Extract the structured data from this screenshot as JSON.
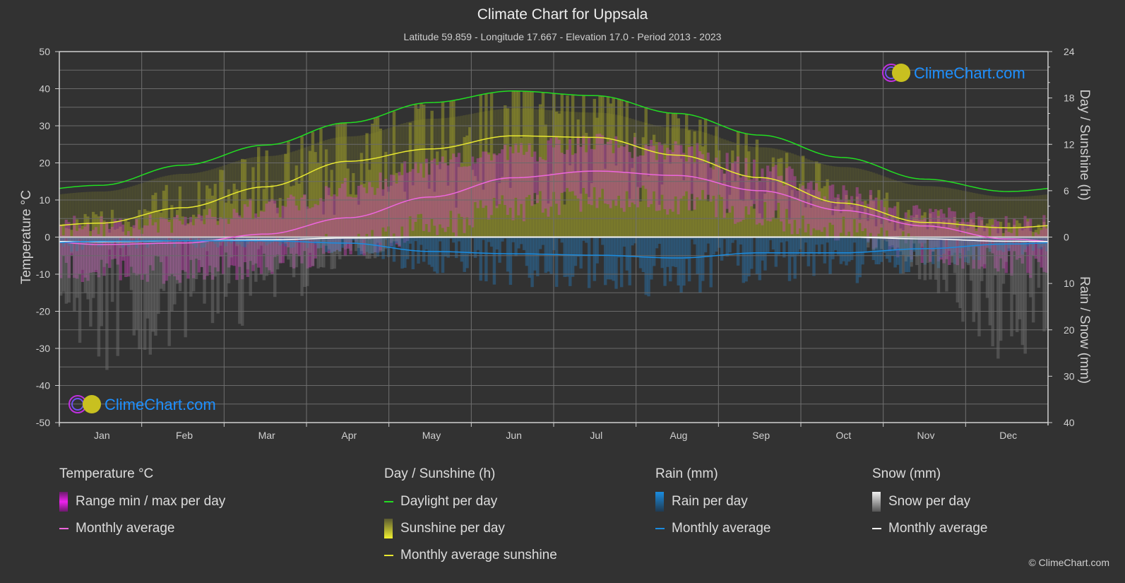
{
  "header": {
    "title": "Climate Chart for Uppsala",
    "subtitle": "Latitude 59.859 - Longitude 17.667 - Elevation 17.0 - Period 2013 - 2023"
  },
  "watermark": {
    "text": "ClimeChart.com"
  },
  "legend": {
    "temperature": {
      "heading": "Temperature °C",
      "items": [
        "Range min / max per day",
        "Monthly average"
      ]
    },
    "sunshine": {
      "heading": "Day / Sunshine (h)",
      "items": [
        "Daylight per day",
        "Sunshine per day",
        "Monthly average sunshine"
      ]
    },
    "rain": {
      "heading": "Rain (mm)",
      "items": [
        "Rain per day",
        "Monthly average"
      ]
    },
    "snow": {
      "heading": "Snow (mm)",
      "items": [
        "Snow per day",
        "Monthly average"
      ]
    }
  },
  "copyright": "© ClimeChart.com",
  "colors": {
    "background": "#323232",
    "daylight": "#22dd22",
    "sunshine_avg": "#e8e830",
    "sunshine_fill": "#9a9a2a",
    "temp_avg": "#ee66dd",
    "temp_range": "#cc44bb",
    "rain_avg": "#1a8ce0",
    "rain_fill": "#2a6a9a",
    "snow_avg": "#ffffff",
    "snow_fill": "#8a8a8a"
  },
  "chart_data": {
    "type": "line",
    "title": "Climate Chart for Uppsala",
    "categories": [
      "Jan",
      "Feb",
      "Mar",
      "Apr",
      "May",
      "Jun",
      "Jul",
      "Aug",
      "Sep",
      "Oct",
      "Nov",
      "Dec"
    ],
    "axes": {
      "left": {
        "label": "Temperature °C",
        "range": [
          -50,
          50
        ],
        "ticks": [
          50,
          40,
          30,
          20,
          10,
          0,
          -10,
          -20,
          -30,
          -40,
          -50
        ]
      },
      "right_top": {
        "label": "Day / Sunshine (h)",
        "range": [
          0,
          24
        ],
        "ticks": [
          24,
          18,
          12,
          6,
          0
        ]
      },
      "right_bottom": {
        "label": "Rain / Snow (mm)",
        "range": [
          0,
          40
        ],
        "ticks": [
          0,
          10,
          20,
          30,
          40
        ],
        "inverted": true
      }
    },
    "grid": true,
    "legend_position": "bottom",
    "series": [
      {
        "name": "Daylight per day",
        "axis": "right_top",
        "unit": "h",
        "values": [
          6.7,
          9.3,
          11.9,
          14.8,
          17.4,
          18.9,
          18.3,
          16.0,
          13.2,
          10.3,
          7.5,
          5.9
        ]
      },
      {
        "name": "Monthly average sunshine",
        "axis": "right_top",
        "unit": "h",
        "values": [
          1.8,
          3.8,
          6.5,
          9.8,
          11.4,
          13.1,
          12.9,
          10.6,
          7.7,
          4.4,
          1.9,
          1.2
        ]
      },
      {
        "name": "Temperature monthly average",
        "axis": "left",
        "unit": "°C",
        "values": [
          -2.0,
          -1.6,
          0.8,
          5.2,
          10.8,
          16.0,
          17.8,
          16.6,
          12.5,
          7.2,
          3.0,
          -0.5
        ]
      },
      {
        "name": "Temperature daily max (approx)",
        "axis": "left",
        "unit": "°C",
        "values": [
          3,
          4,
          8,
          13,
          19,
          23,
          25,
          23,
          18,
          11,
          6,
          3
        ]
      },
      {
        "name": "Temperature daily min (approx)",
        "axis": "left",
        "unit": "°C",
        "values": [
          -9,
          -9,
          -7,
          -2,
          3,
          8,
          11,
          10,
          6,
          2,
          -3,
          -7
        ]
      },
      {
        "name": "Rain monthly average",
        "axis": "right_bottom",
        "unit": "mm",
        "values": [
          0.9,
          0.8,
          0.8,
          1.3,
          3.1,
          3.6,
          3.9,
          4.5,
          3.4,
          3.4,
          2.5,
          1.5
        ]
      },
      {
        "name": "Snow monthly average",
        "axis": "right_bottom",
        "unit": "mm",
        "values": [
          1.0,
          0.8,
          0.6,
          0.2,
          0.0,
          0.0,
          0.0,
          0.0,
          0.0,
          0.0,
          0.4,
          0.9
        ]
      }
    ]
  }
}
